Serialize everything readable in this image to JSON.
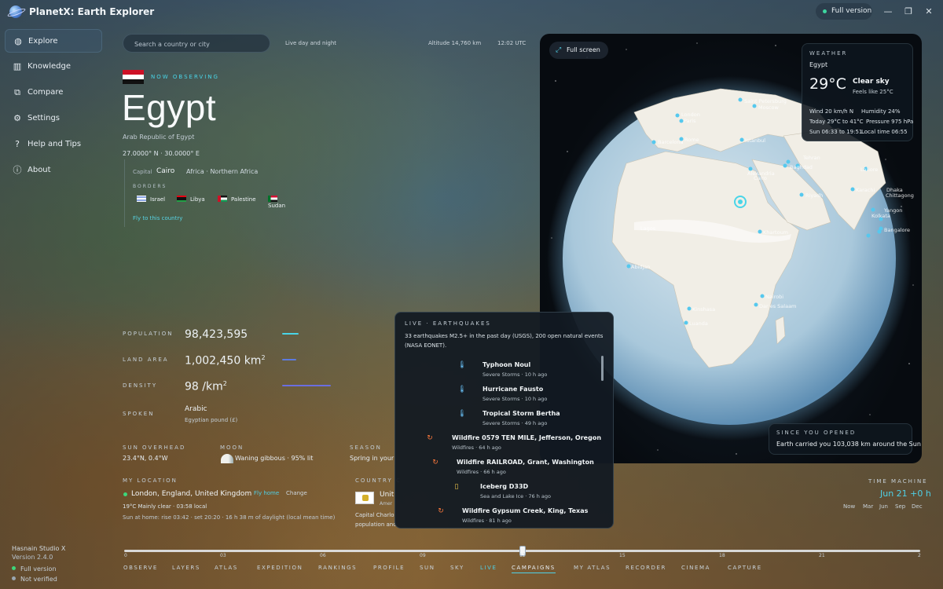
{
  "app": {
    "title": "PlanetX: Earth Explorer",
    "full_version_label": "Full version"
  },
  "window_controls": {
    "minimize": "—",
    "maximize": "❐",
    "close": "✕"
  },
  "sidebar": {
    "items": [
      {
        "label": "Explore",
        "icon": "globe-icon"
      },
      {
        "label": "Knowledge",
        "icon": "books-icon"
      },
      {
        "label": "Compare",
        "icon": "compare-icon"
      },
      {
        "label": "Settings",
        "icon": "gear-icon"
      },
      {
        "label": "Help and Tips",
        "icon": "question-icon"
      },
      {
        "label": "About",
        "icon": "info-icon"
      }
    ],
    "studio": "Hasnain Studio X",
    "version": "Version 2.4.0",
    "full_version": "Full version",
    "not_verified": "Not verified"
  },
  "topbar": {
    "search_placeholder": "Search a country or city",
    "live_day_night": "Live day and night",
    "altitude": "Altitude 14,760 km",
    "utc_time": "12:02 UTC"
  },
  "country": {
    "now_observing": "NOW OBSERVING",
    "name": "Egypt",
    "official": "Arab Republic of Egypt",
    "lat": "27.0000° N",
    "lon": "30.0000° E",
    "capital_label": "Capital",
    "capital": "Cairo",
    "region": "Africa · Northern Africa",
    "borders_label": "BORDERS",
    "borders": [
      "Israel",
      "Libya",
      "Palestine",
      "Sudan"
    ],
    "fly_link": "Fly to this country"
  },
  "stats": {
    "population_label": "POPULATION",
    "population": "98,423,595",
    "land_label": "LAND AREA",
    "land": "1,002,450 km",
    "land_unit_sup": "2",
    "density_label": "DENSITY",
    "density": "98 /km",
    "density_unit_sup": "2",
    "spoken_label": "SPOKEN",
    "spoken": "Arabic",
    "currency": "Egyptian pound (£)",
    "bar_levels": {
      "population": 0.28,
      "land": 0.24,
      "density": 0.81
    }
  },
  "sky": {
    "sun_label": "SUN OVERHEAD",
    "sun_value": "23.4°N, 0.4°W",
    "moon_label": "MOON",
    "moon_value": "Waning gibbous · 95% lit",
    "season_label": "SEASON",
    "season_value": "Spring in your"
  },
  "my_location": {
    "label": "MY LOCATION",
    "place": "London, England, United Kingdom",
    "fly_home": "Fly home",
    "change": "Change",
    "weather": "19°C Mainly clear · 03:58 local",
    "sun": "Sun at home: rise 03:42 · set 20:20 · 16 h 38 m of daylight (local mean time)"
  },
  "country_card": {
    "label": "COUNTRY C",
    "name": "Unit",
    "sub": "Amer",
    "line1": "Capital Charlo",
    "line2": "population and"
  },
  "time_machine": {
    "label": "TIME MACHINE",
    "date": "Jun 21 +0 h",
    "months": [
      "Now",
      "Mar",
      "Jun",
      "Sep",
      "Dec"
    ]
  },
  "timeline": {
    "ticks": [
      "0",
      "03",
      "06",
      "09",
      "12",
      "15",
      "18",
      "21",
      "2"
    ],
    "position": 0.5
  },
  "tabs": [
    "OBSERVE",
    "LAYERS",
    "ATLAS",
    "EXPEDITION",
    "RANKINGS",
    "PROFILE",
    "SUN",
    "SKY",
    "LIVE",
    "CAMPAIGNS",
    "MY ATLAS",
    "RECORDER",
    "CINEMA",
    "CAPTURE"
  ],
  "globe": {
    "full_screen": "Full screen",
    "cities": [
      "Saint Petersburg",
      "Moscow",
      "London",
      "Paris",
      "Barcelona",
      "Rome",
      "Istanbul",
      "Tehran",
      "Baghdad",
      "Riyadh",
      "Alexandria",
      "Cairo",
      "Khartoum",
      "Lahore",
      "Karachi",
      "Dhaka",
      "Chittagong",
      "Yangon",
      "Bangalore",
      "Kolkata",
      "Abidjan",
      "Kinshasa",
      "Luanda",
      "Nairobi",
      "Dar es Salaam",
      "Lagos"
    ]
  },
  "weather": {
    "label": "WEATHER",
    "place": "Egypt",
    "temp": "29°C",
    "condition": "Clear sky",
    "feels": "Feels like 25°C",
    "wind": "Wind 20 km/h N",
    "humidity": "Humidity 24%",
    "today": "Today 29°C to 41°C",
    "pressure": "Pressure 975 hPa",
    "sun": "Sun 06:33 to 19:51",
    "local_time": "Local time 06:55"
  },
  "since_opened": {
    "label": "SINCE YOU OPENED",
    "value": "Earth carried you 103,038 km around the Sun"
  },
  "live_panel": {
    "label": "LIVE · EARTHQUAKES",
    "summary": "33 earthquakes M2.5+ in the past day (USGS), 200 open natural events (NASA EONET).",
    "events": [
      {
        "title": "Typhoon Noul",
        "sub": "Severe Storms · 10 h ago",
        "icon": "thermometer-icon"
      },
      {
        "title": "Hurricane Fausto",
        "sub": "Severe Storms · 10 h ago",
        "icon": "thermometer-icon"
      },
      {
        "title": "Tropical Storm Bertha",
        "sub": "Severe Storms · 49 h ago",
        "icon": "thermometer-icon"
      },
      {
        "title": "Wildfire 0579 TEN MILE, Jefferson, Oregon",
        "sub": "Wildfires · 64 h ago",
        "icon": "fire-icon"
      },
      {
        "title": "Wildfire RAILROAD, Grant, Washington",
        "sub": "Wildfires · 66 h ago",
        "icon": "fire-icon"
      },
      {
        "title": "Iceberg D33D",
        "sub": "Sea and Lake Ice · 76 h ago",
        "icon": "iceberg-icon"
      },
      {
        "title": "Wildfire Gypsum Creek, King, Texas",
        "sub": "Wildfires · 81 h ago",
        "icon": "fire-icon"
      }
    ]
  },
  "colors": {
    "accent": "#4fd0e6",
    "status_green": "#3dd67a",
    "fire": "#ff7a3c",
    "storm": "#6cc7ff"
  }
}
